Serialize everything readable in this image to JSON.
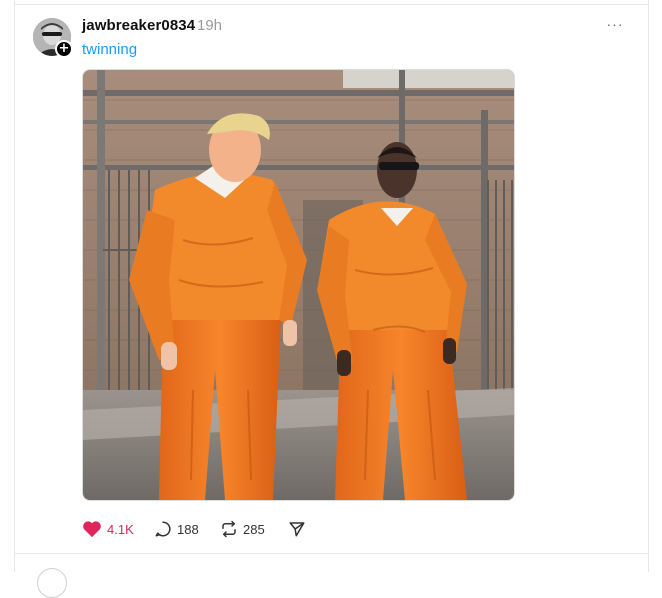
{
  "post": {
    "username": "jawbreaker0834",
    "time_ago": "19h",
    "caption": "twinning",
    "follow_badge": "+",
    "more_label": "···",
    "media_icon": "photo",
    "actions": {
      "like_count": "4.1K",
      "reply_count": "188",
      "repost_count": "285",
      "like_icon": "heart-filled-icon",
      "reply_icon": "comment-bubble-icon",
      "repost_icon": "repost-arrows-icon",
      "share_icon": "send-icon"
    }
  },
  "colors": {
    "link_blue": "#1d9bf0",
    "like_red": "#e0245e",
    "timestamp_gray": "#9a9a9a",
    "jumpsuit_orange": "#f07a1c"
  }
}
